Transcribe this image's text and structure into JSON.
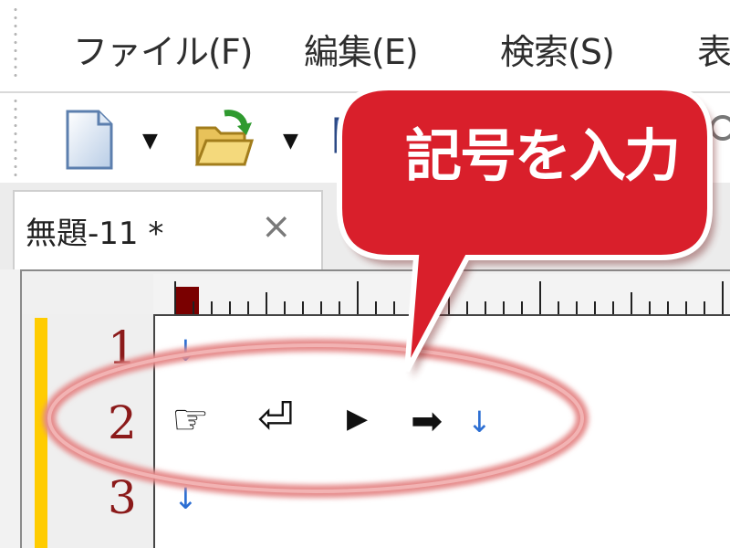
{
  "menubar": {
    "items": [
      {
        "label": "ファイル(F)"
      },
      {
        "label": "編集(E)"
      },
      {
        "label": "検索(S)"
      },
      {
        "label": "表"
      }
    ]
  },
  "toolbar": {
    "buttons": [
      {
        "icon": "new-document-icon"
      },
      {
        "icon": "dropdown-arrow-icon"
      },
      {
        "icon": "open-folder-icon"
      },
      {
        "icon": "dropdown-arrow-icon"
      },
      {
        "icon": "save-icon"
      },
      {
        "icon": "search-icon"
      }
    ],
    "dropdown_glyph": "▼"
  },
  "tabs": [
    {
      "label": "無題-11 *",
      "close_glyph": "×"
    }
  ],
  "editor": {
    "lines": [
      {
        "number": "1",
        "eol": "↓"
      },
      {
        "number": "2",
        "symbols": [
          "☞",
          "⏎",
          "▶",
          "➡"
        ],
        "eol": "↓"
      },
      {
        "number": "3",
        "eol": "↓"
      }
    ]
  },
  "callout": {
    "text": "記号を入力"
  },
  "colors": {
    "accent_red": "#d91f2b",
    "highlight_ellipse": "#e58a8a",
    "line_number": "#8b1a1a",
    "eol_mark": "#2d6fd3",
    "gutter_marker": "#ffcc00"
  }
}
